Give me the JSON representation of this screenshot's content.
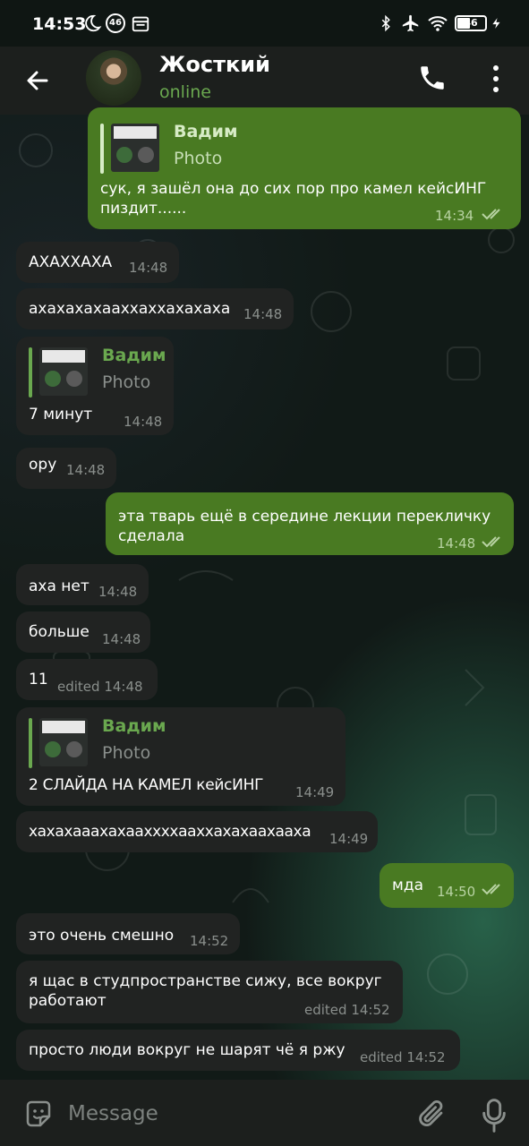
{
  "status_bar": {
    "time": "14:53",
    "notif_badge": "46",
    "battery": "46"
  },
  "header": {
    "contact_name": "Жосткий",
    "contact_status": "online"
  },
  "messages": [
    {
      "dir": "out",
      "reply_name": "Вадим",
      "reply_type": "Photo",
      "text": "сук, я зашёл она до сих пор про камел кейсИНГ\nпиздит......",
      "time": "14:34",
      "read": true
    },
    {
      "dir": "in",
      "text": "АХАХХАХА",
      "time": "14:48"
    },
    {
      "dir": "in",
      "text": "ахахахахааххаххахахаха",
      "time": "14:48"
    },
    {
      "dir": "in",
      "reply_name": "Вадим",
      "reply_type": "Photo",
      "text": "7 минут",
      "time": "14:48"
    },
    {
      "dir": "in",
      "text": "ору",
      "time": "14:48"
    },
    {
      "dir": "out",
      "text": "эта тварь ещё в середине лекции перекличку\nсделала",
      "time": "14:48",
      "read": true
    },
    {
      "dir": "in",
      "text": "аха нет",
      "time": "14:48"
    },
    {
      "dir": "in",
      "text": "больше",
      "time": "14:48"
    },
    {
      "dir": "in",
      "text": "11",
      "time": "edited 14:48"
    },
    {
      "dir": "in",
      "reply_name": "Вадим",
      "reply_type": "Photo",
      "text": "2 СЛАЙДА НА КАМЕЛ кейсИНГ",
      "time": "14:49"
    },
    {
      "dir": "in",
      "text": "хахахааахахааххххааххахахаахааха",
      "time": "14:49"
    },
    {
      "dir": "out",
      "text": "мда",
      "time": "14:50",
      "read": true
    },
    {
      "dir": "in",
      "text": "это очень смешно",
      "time": "14:52"
    },
    {
      "dir": "in",
      "text": "я щас в студпространстве сижу, все вокруг\nработают",
      "time": "edited 14:52"
    },
    {
      "dir": "in",
      "text": "просто люди вокруг не шарят чё я ржу",
      "time": "edited 14:52"
    }
  ],
  "input": {
    "placeholder": "Message"
  },
  "icons": {
    "back": "arrow-left-icon",
    "call": "phone-icon",
    "more": "more-vertical-icon",
    "emoji": "sticker-icon",
    "attach": "paperclip-icon",
    "mic": "microphone-icon"
  },
  "colors": {
    "incoming_bubble": "#212322",
    "outgoing_bubble": "#497a22",
    "accent": "#6aa84f",
    "header_bg": "#1c1f1d"
  }
}
